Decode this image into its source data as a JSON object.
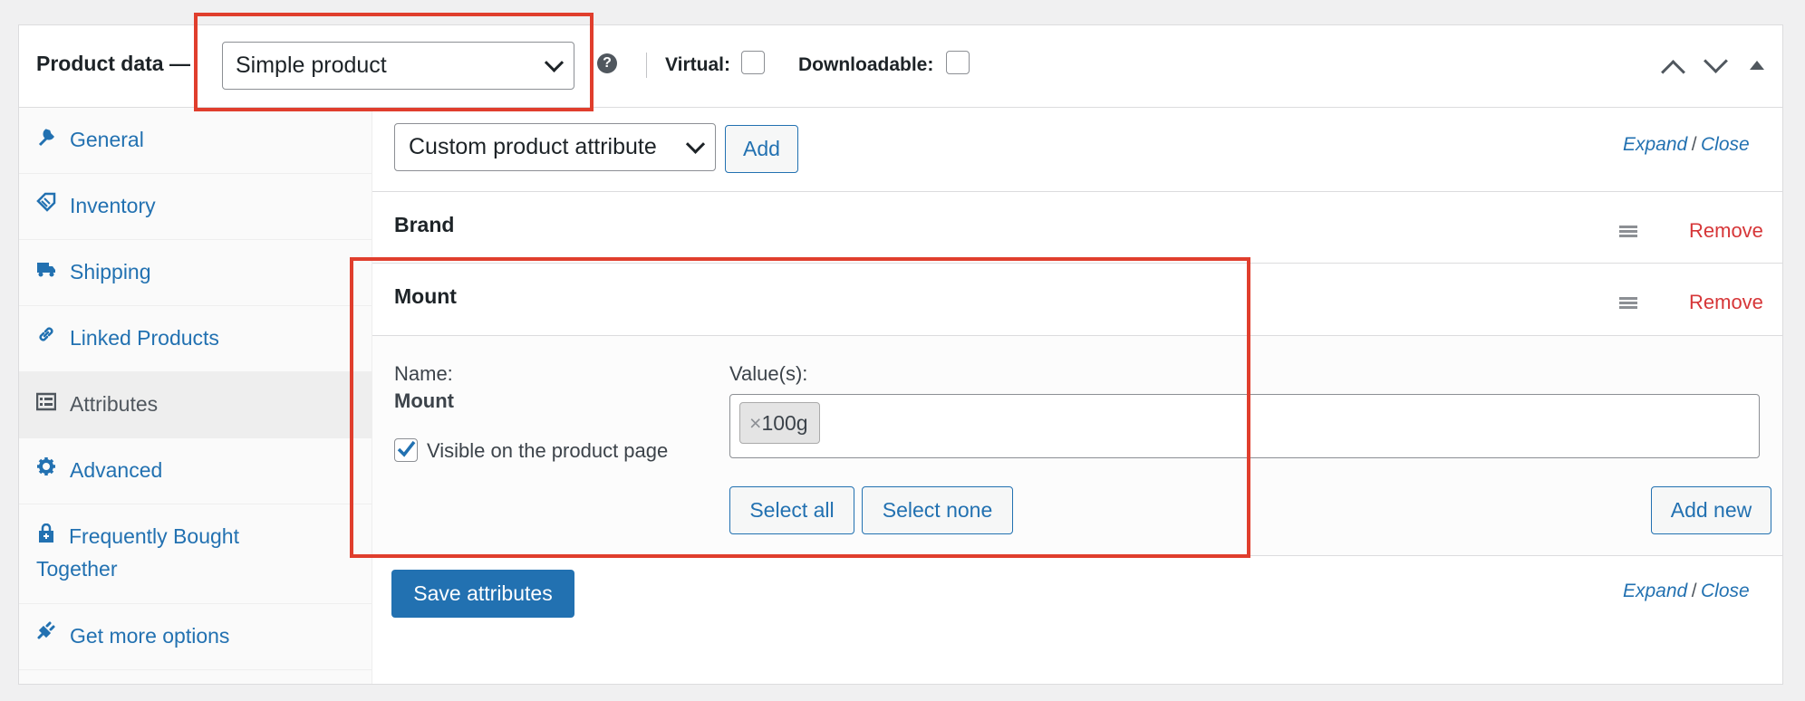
{
  "header": {
    "title": "Product data —",
    "product_type": "Simple product",
    "help_glyph": "?",
    "virtual_label": "Virtual:",
    "downloadable_label": "Downloadable:"
  },
  "sidebar": {
    "items": [
      {
        "label": "General",
        "icon": "wrench-icon"
      },
      {
        "label": "Inventory",
        "icon": "tag-icon"
      },
      {
        "label": "Shipping",
        "icon": "truck-icon"
      },
      {
        "label": "Linked Products",
        "icon": "link-icon"
      },
      {
        "label": "Attributes",
        "icon": "list-icon"
      },
      {
        "label": "Advanced",
        "icon": "gear-icon"
      },
      {
        "label": "Frequently Bought",
        "label2": "Together",
        "icon": "bag-icon"
      },
      {
        "label": "Get more options",
        "icon": "plug-icon"
      }
    ],
    "active": "Attributes"
  },
  "toolbar": {
    "attribute_select": "Custom product attribute",
    "add_label": "Add",
    "expand_label": "Expand",
    "sep": "/",
    "close_label": "Close"
  },
  "attributes": [
    {
      "name": "Brand",
      "remove_label": "Remove"
    },
    {
      "name": "Mount",
      "remove_label": "Remove"
    }
  ],
  "mount_detail": {
    "name_label": "Name:",
    "name_value": "Mount",
    "values_label": "Value(s):",
    "chip_remove": "×",
    "chip_value": "100g",
    "visible_label": "Visible on the product page",
    "select_all": "Select all",
    "select_none": "Select none",
    "add_new": "Add new"
  },
  "footer": {
    "save_label": "Save attributes",
    "expand_label": "Expand",
    "sep": "/",
    "close_label": "Close"
  },
  "colors": {
    "accent": "#2271b1",
    "remove": "#d63638",
    "highlight": "#e03e2d"
  }
}
